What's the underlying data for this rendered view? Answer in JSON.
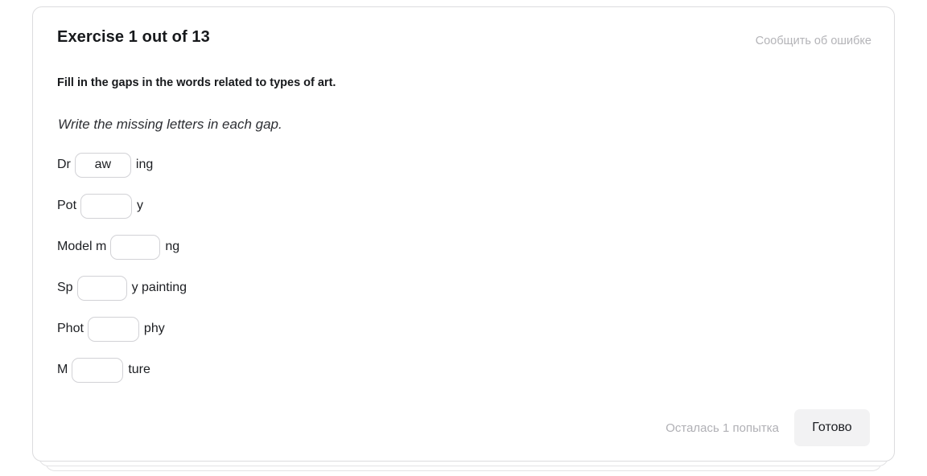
{
  "header": {
    "title": "Exercise 1 out of 13",
    "report_error_label": "Сообщить об ошибке"
  },
  "prompt": {
    "statement": "Fill in the gaps in the words related to types of art.",
    "hint": "Write the missing letters in each gap."
  },
  "gaps": [
    {
      "prefix": "Dr",
      "value": "aw",
      "suffix": "ing",
      "input_width": 70
    },
    {
      "prefix": "Pot",
      "value": "",
      "suffix": "y",
      "input_width": 64
    },
    {
      "prefix": "Model m",
      "value": "",
      "suffix": "ng",
      "input_width": 62
    },
    {
      "prefix": "Sp",
      "value": "",
      "suffix": "y painting",
      "input_width": 62
    },
    {
      "prefix": "Phot",
      "value": "",
      "suffix": "phy",
      "input_width": 64
    },
    {
      "prefix": "M",
      "value": "",
      "suffix": "ture",
      "input_width": 64
    }
  ],
  "footer": {
    "attempts_label": "Осталась 1 попытка",
    "submit_label": "Готово"
  },
  "colors": {
    "page_background": "#ffffff",
    "card_background": "#ffffff",
    "card_border": "#dcdcde",
    "text_primary": "#17191c",
    "text_muted": "#b0b0b5",
    "input_border": "#d2d2d6",
    "button_background": "#f2f2f3"
  }
}
